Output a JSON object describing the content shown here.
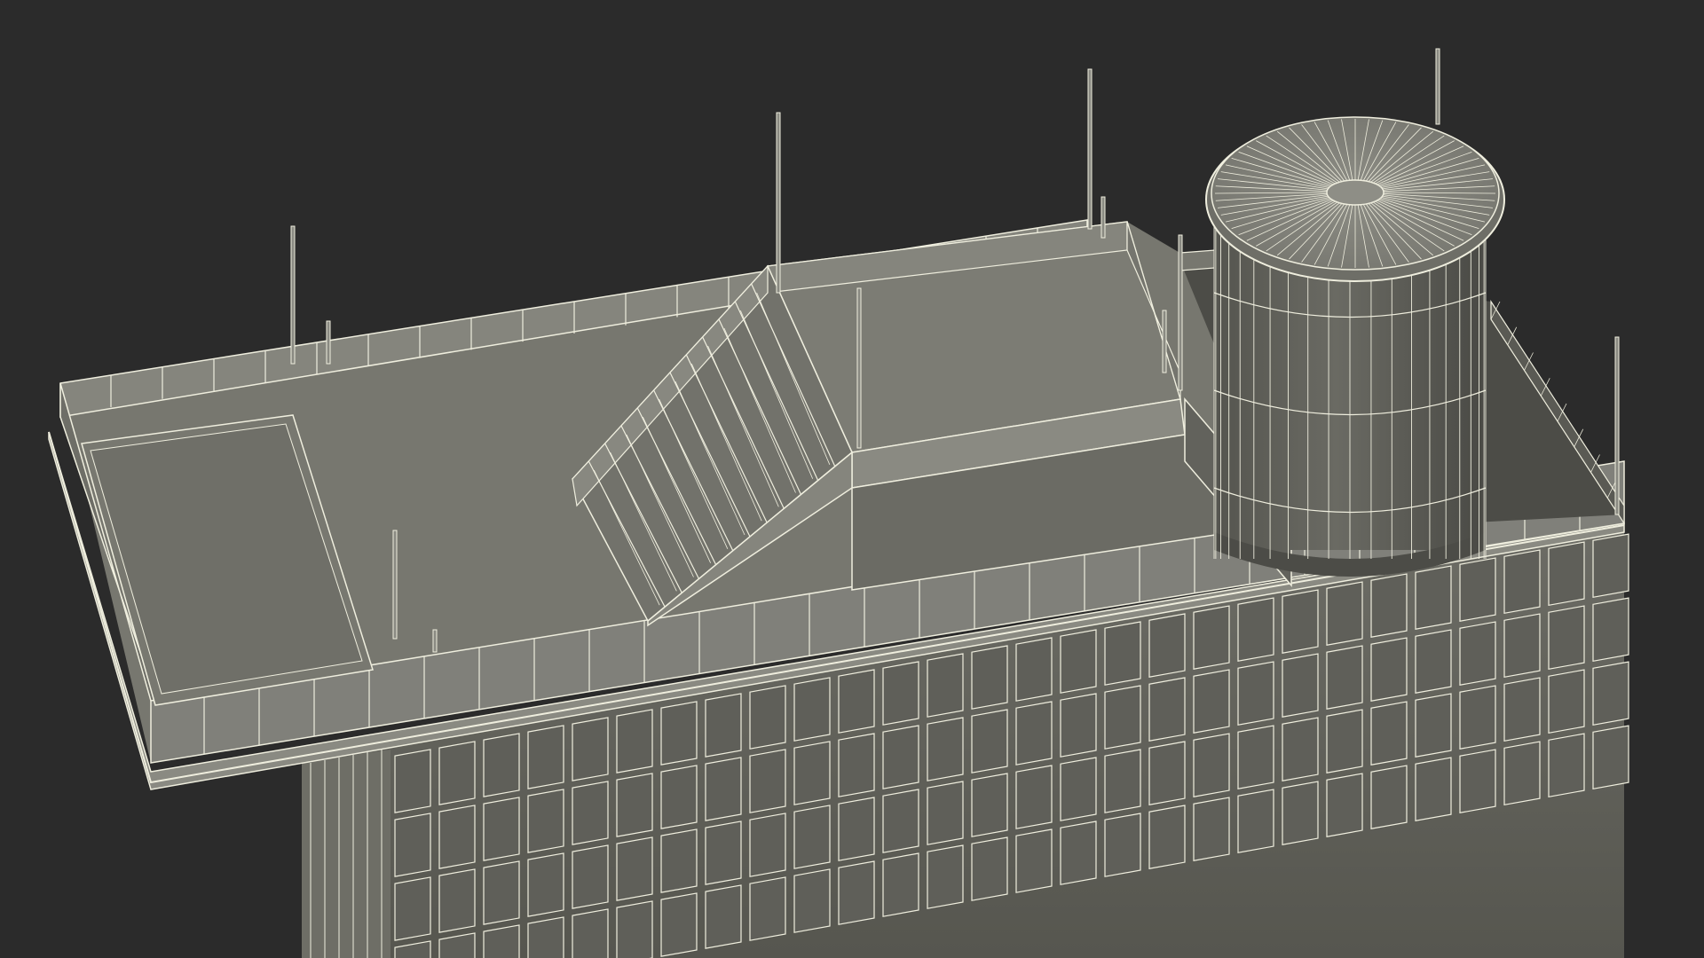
{
  "scene": {
    "subject": "building-rooftop-wireframe",
    "background_color": "#2b2b2b",
    "surface_color": "#7a7a72",
    "surface_light": "#8a8a82",
    "surface_dark": "#5e5e58",
    "wire_color": "#efeede"
  }
}
